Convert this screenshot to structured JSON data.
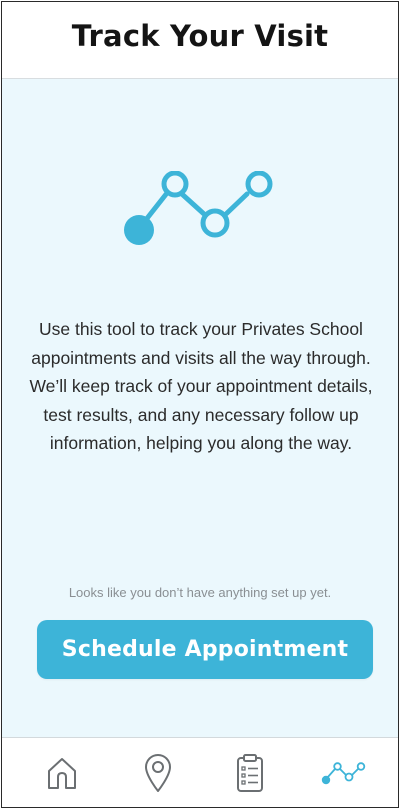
{
  "header": {
    "title": "Track Your Visit"
  },
  "main": {
    "hero_icon": "tracking-path-icon",
    "description": "Use this tool to track your Privates School appointments and visits all the way through. We’ll keep track of your appointment details, test results, and any necessary follow up information, helping you along the way.",
    "empty_note": "Looks like you don’t have anything set up yet.",
    "cta_label": "Schedule Appointment"
  },
  "tabbar": {
    "items": [
      {
        "icon": "home-icon",
        "active": false
      },
      {
        "icon": "location-pin-icon",
        "active": false
      },
      {
        "icon": "clipboard-list-icon",
        "active": false
      },
      {
        "icon": "tracking-path-icon",
        "active": true
      }
    ]
  },
  "colors": {
    "accent": "#3db4d8",
    "background": "#ebf8fd",
    "icon_inactive": "#6b6f72",
    "text": "#2b2b2b"
  }
}
